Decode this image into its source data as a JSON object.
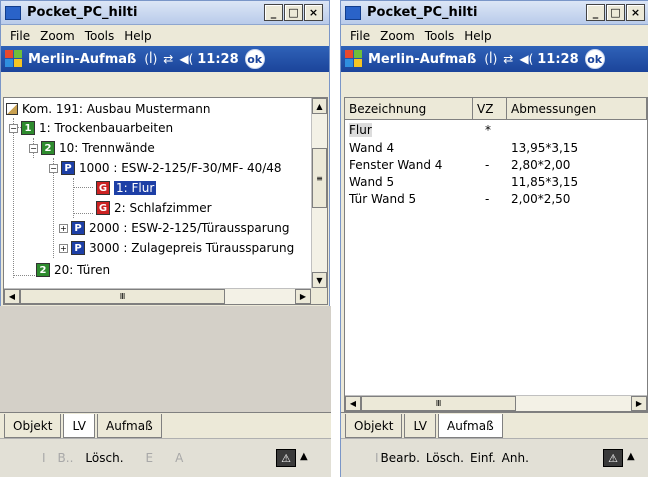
{
  "left": {
    "window_title": "Pocket_PC_hilti",
    "controls": {
      "minimize": "_",
      "maximize": "□",
      "close": "×"
    },
    "menu": [
      "File",
      "Zoom",
      "Tools",
      "Help"
    ],
    "app_title": "Merlin-Aufmaß",
    "time": "11:28",
    "ok": "ok",
    "tree": [
      {
        "label": "Kom. 191: Ausbau Mustermann"
      },
      {
        "badge": "1",
        "label": "1: Trockenbauarbeiten"
      },
      {
        "badge": "2",
        "label": "10: Trennwände"
      },
      {
        "badge": "P",
        "label": "1000 : ESW-2-125/F-30/MF- 40/48"
      },
      {
        "badge": "G",
        "label": "1: Flur",
        "selected": true
      },
      {
        "badge": "G",
        "label": "2: Schlafzimmer"
      },
      {
        "badge": "P",
        "label": "2000 : ESW-2-125/Türaussparung"
      },
      {
        "badge": "P",
        "label": "3000 : Zulagepreis Türaussparung"
      },
      {
        "badge": "2",
        "label": "20: Türen"
      }
    ],
    "scroll_thumb": "Ⅲ",
    "tabs": [
      "Objekt",
      "LV",
      "Aufmaß"
    ],
    "active_tab": "LV",
    "commands": [
      "I",
      "B..",
      "Lösch.",
      "E",
      "A"
    ]
  },
  "right": {
    "window_title": "Pocket_PC_hilti",
    "controls": {
      "minimize": "_",
      "maximize": "□",
      "close": "×"
    },
    "menu": [
      "File",
      "Zoom",
      "Tools",
      "Help"
    ],
    "app_title": "Merlin-Aufmaß",
    "time": "11:28",
    "ok": "ok",
    "columns": [
      "Bezeichnung",
      "VZ",
      "Abmessungen"
    ],
    "rows": [
      {
        "name": "Flur",
        "vz": "*",
        "dim": ""
      },
      {
        "name": "Wand 4",
        "vz": "",
        "dim": "13,95*3,15"
      },
      {
        "name": "Fenster Wand 4",
        "vz": "-",
        "dim": "2,80*2,00"
      },
      {
        "name": "Wand 5",
        "vz": "",
        "dim": "11,85*3,15"
      },
      {
        "name": "Tür Wand 5",
        "vz": "-",
        "dim": "2,00*2,50"
      }
    ],
    "scroll_thumb": "Ⅲ",
    "tabs": [
      "Objekt",
      "LV",
      "Aufmaß"
    ],
    "active_tab": "Aufmaß",
    "commands": [
      "I",
      "Bearb.",
      "Lösch.",
      "Einf.",
      "Anh."
    ]
  },
  "colors": {
    "app_bar": "#2f62b8",
    "badge_green": "#2e8b2e",
    "badge_blue": "#1d3fa6",
    "badge_red": "#cc2222"
  },
  "icons": [
    "windows-flag-icon",
    "antenna-icon",
    "sync-icon",
    "speaker-icon",
    "ok-icon",
    "tree-root-icon",
    "sip-keyboard-icon"
  ]
}
